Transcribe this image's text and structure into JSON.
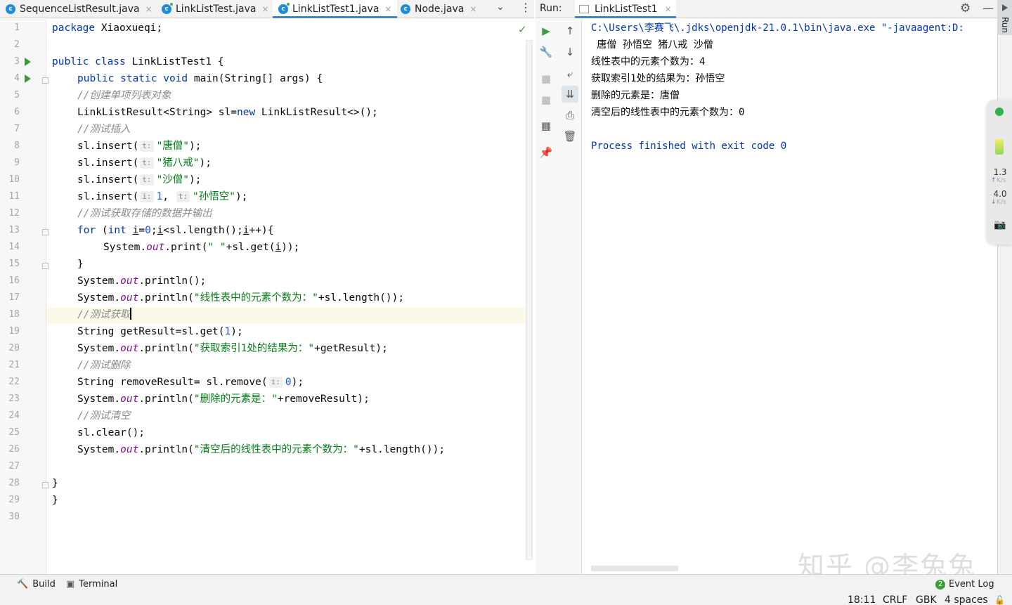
{
  "editor_tabs": [
    {
      "label": "SequenceListResult.java",
      "icon": "class-icon",
      "active": false
    },
    {
      "label": "LinkListTest.java",
      "icon": "class-icon",
      "active": false
    },
    {
      "label": "LinkListTest1.java",
      "icon": "runnable-class-icon",
      "active": true
    },
    {
      "label": "Node.java",
      "icon": "class-icon",
      "active": false
    }
  ],
  "icon_glyphs": {
    "close": "×",
    "class": "c",
    "tabs_menu": "⌄",
    "more": "⋮",
    "check": "✓",
    "gear": "⚙",
    "minimize": "—"
  },
  "editor": {
    "line_numbers": [
      "1",
      "2",
      "3",
      "4",
      "5",
      "6",
      "7",
      "8",
      "9",
      "10",
      "11",
      "12",
      "13",
      "14",
      "15",
      "16",
      "17",
      "18",
      "19",
      "20",
      "21",
      "22",
      "23",
      "24",
      "25",
      "26",
      "27",
      "28",
      "29",
      "30"
    ],
    "code": {
      "l1_kw": "package",
      "l1_rest": " Xiaoxueqi;",
      "l3_kw": "public class",
      "l3_rest": " LinkListTest1 {",
      "l4_kw": "public static void",
      "l4_rest": " main(String[] args) {",
      "l5_comment": "//创建单项列表对象",
      "l6_a": "LinkListResult<String> sl=",
      "l6_kw": "new",
      "l6_b": " LinkListResult<>();",
      "l7_comment": "//测试插入",
      "l8_a": "sl.insert(",
      "l8_hint": "t:",
      "l8_str": "\"唐僧\"",
      "l8_b": ");",
      "l9_a": "sl.insert(",
      "l9_hint": "t:",
      "l9_str": "\"猪八戒\"",
      "l9_b": ");",
      "l10_a": "sl.insert(",
      "l10_hint": "t:",
      "l10_str": "\"沙僧\"",
      "l10_b": ");",
      "l11_a": "sl.insert(",
      "l11_hint1": "i:",
      "l11_num": "1",
      "l11_comma": ", ",
      "l11_hint2": "t:",
      "l11_str": "\"孙悟空\"",
      "l11_b": ");",
      "l12_comment": "//测试获取存储的数据并输出",
      "l13_kw1": "for",
      "l13_a": " (",
      "l13_kw2": "int",
      "l13_b": " ",
      "l13_i1": "i",
      "l13_c": "=",
      "l13_num": "0",
      "l13_d": ";",
      "l13_i2": "i",
      "l13_e": "<sl.length();",
      "l13_i3": "i",
      "l13_f": "++){",
      "l14_a": "System.",
      "l14_fld": "out",
      "l14_b": ".print(",
      "l14_str": "\" \"",
      "l14_c": "+sl.get(",
      "l14_i": "i",
      "l14_d": "));",
      "l15": "}",
      "l16_a": "System.",
      "l16_fld": "out",
      "l16_b": ".println();",
      "l17_a": "System.",
      "l17_fld": "out",
      "l17_b": ".println(",
      "l17_str": "\"线性表中的元素个数为：\"",
      "l17_c": "+sl.length());",
      "l18_comment": "//测试获取",
      "l19_a": "String getResult=sl.get(",
      "l19_num": "1",
      "l19_b": ");",
      "l20_a": "System.",
      "l20_fld": "out",
      "l20_b": ".println(",
      "l20_str": "\"获取索引1处的结果为：\"",
      "l20_c": "+getResult);",
      "l21_comment": "//测试删除",
      "l22_a": "String removeResult= sl.remove(",
      "l22_hint": "i:",
      "l22_num": "0",
      "l22_b": ");",
      "l23_a": "System.",
      "l23_fld": "out",
      "l23_b": ".println(",
      "l23_str": "\"删除的元素是：\"",
      "l23_c": "+removeResult);",
      "l24_comment": "//测试清空",
      "l25": "sl.clear();",
      "l26_a": "System.",
      "l26_fld": "out",
      "l26_b": ".println(",
      "l26_str": "\"清空后的线性表中的元素个数为：\"",
      "l26_c": "+sl.length());",
      "l28": "}",
      "l29": "}"
    }
  },
  "run": {
    "label": "Run:",
    "tab_label": "LinkListTest1",
    "side_label": "Run",
    "console_lines": [
      "C:\\Users\\李赛飞\\.jdks\\openjdk-21.0.1\\bin\\java.exe \"-javaagent:D:",
      " 唐僧 孙悟空 猪八戒 沙僧",
      "线性表中的元素个数为：4",
      "获取索引1处的结果为：孙悟空",
      "删除的元素是：唐僧",
      "清空后的线性表中的元素个数为：0",
      "",
      "Process finished with exit code 0"
    ],
    "toolbar": {
      "rerun": "▶",
      "up": "↑",
      "down": "↓",
      "wrap": "⤶",
      "scroll_end": "⇊",
      "settings": "🔧",
      "stop": "■",
      "print": "⎙",
      "layout": "▦",
      "trash": "🗑",
      "pin": "📌"
    }
  },
  "monitor": {
    "up_value": "1.3",
    "up_unit": "K/s",
    "down_value": "4.0",
    "down_unit": "K/s",
    "up_arrow": "↑",
    "down_arrow": "↓",
    "camera": "📷"
  },
  "watermark": "知乎 @李兔兔",
  "bottom_tools": {
    "build": "Build",
    "terminal": "Terminal",
    "event_log": "Event Log",
    "event_count": "2",
    "build_icon": "🔨",
    "terminal_icon": "▣"
  },
  "status_bar": {
    "position": "18:11",
    "line_sep": "CRLF",
    "encoding": "GBK",
    "indent": "4 spaces",
    "lock": "🔓"
  }
}
